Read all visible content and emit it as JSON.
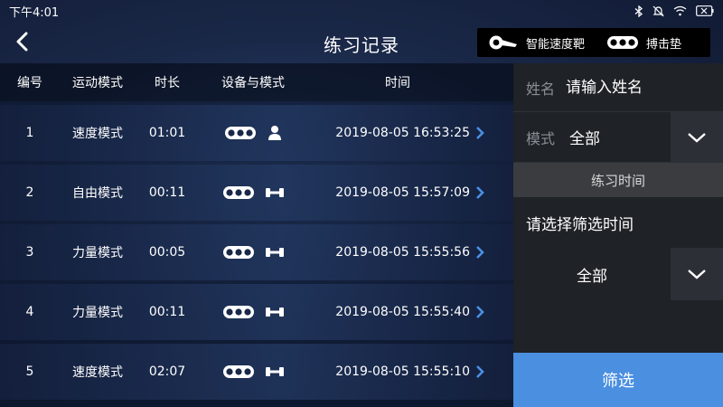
{
  "status": {
    "time": "下午4:01"
  },
  "header": {
    "title": "练习记录",
    "legend": [
      {
        "icon": "speed-target-icon",
        "label": "智能速度靶"
      },
      {
        "icon": "strike-pad-icon",
        "label": "搏击垫"
      }
    ]
  },
  "table": {
    "columns": [
      "编号",
      "运动模式",
      "时长",
      "设备与模式",
      "时间"
    ],
    "rows": [
      {
        "no": "1",
        "mode": "速度模式",
        "duration": "01:01",
        "device": "strike-pad-icon",
        "device_mode": "person-icon",
        "time": "2019-08-05 16:53:25"
      },
      {
        "no": "2",
        "mode": "自由模式",
        "duration": "00:11",
        "device": "strike-pad-icon",
        "device_mode": "dumbbell-icon",
        "time": "2019-08-05 15:57:09"
      },
      {
        "no": "3",
        "mode": "力量模式",
        "duration": "00:05",
        "device": "strike-pad-icon",
        "device_mode": "dumbbell-icon",
        "time": "2019-08-05 15:55:56"
      },
      {
        "no": "4",
        "mode": "力量模式",
        "duration": "00:11",
        "device": "strike-pad-icon",
        "device_mode": "dumbbell-icon",
        "time": "2019-08-05 15:55:40"
      },
      {
        "no": "5",
        "mode": "速度模式",
        "duration": "02:07",
        "device": "strike-pad-icon",
        "device_mode": "dumbbell-icon",
        "time": "2019-08-05 15:55:10"
      }
    ]
  },
  "filter": {
    "name_label": "姓名",
    "name_placeholder": "请输入姓名",
    "mode_label": "模式",
    "mode_value": "全部",
    "time_header": "练习时间",
    "time_prompt": "请选择筛选时间",
    "time_value": "全部",
    "submit_label": "筛选"
  },
  "colors": {
    "accent": "#4a8fe0",
    "panel": "#1f2226",
    "chevron": "#4a90e2"
  }
}
